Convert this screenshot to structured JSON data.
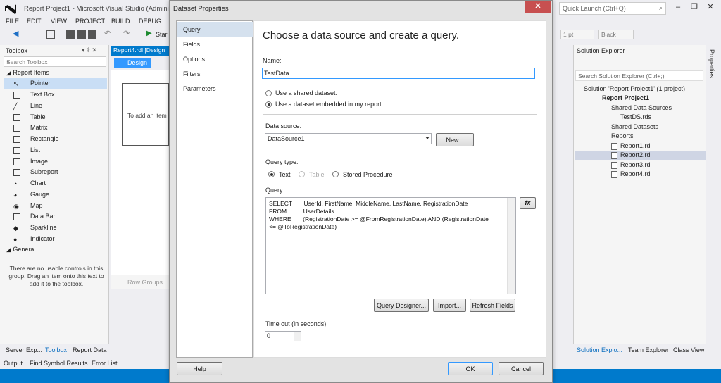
{
  "app": {
    "title": "Report Project1 - Microsoft Visual Studio (Administ",
    "quick_launch_placeholder": "Quick Launch (Ctrl+Q)"
  },
  "menu": [
    "FILE",
    "EDIT",
    "VIEW",
    "PROJECT",
    "BUILD",
    "DEBUG"
  ],
  "toolbar": {
    "start_label": "Star",
    "font_size": "1 pt",
    "color": "Black"
  },
  "toolbox": {
    "title": "Toolbox",
    "search_placeholder": "Search Toolbox",
    "group_report_items": "Report Items",
    "items": [
      "Pointer",
      "Text Box",
      "Line",
      "Table",
      "Matrix",
      "Rectangle",
      "List",
      "Image",
      "Subreport",
      "Chart",
      "Gauge",
      "Map",
      "Data Bar",
      "Sparkline",
      "Indicator"
    ],
    "group_general": "General",
    "empty_text": "There are no usable controls in this group. Drag an item onto this text to add it to the toolbox."
  },
  "document": {
    "tab": "Report4.rdl [Design",
    "design_button": "Design",
    "add_item_text": "To add an item",
    "row_groups": "Row Groups"
  },
  "bottom_tabs": {
    "left": [
      "Server Exp...",
      "Toolbox",
      "Report Data"
    ],
    "output": [
      "Output",
      "Find Symbol Results",
      "Error List"
    ],
    "right": [
      "Solution Explo...",
      "Team Explorer",
      "Class View"
    ]
  },
  "solution_explorer": {
    "title": "Solution Explorer",
    "search_placeholder": "Search Solution Explorer (Ctrl+;)",
    "solution": "Solution 'Report Project1' (1 project)",
    "project": "Report Project1",
    "shared_data_sources": "Shared Data Sources",
    "testds": "TestDS.rds",
    "shared_datasets": "Shared Datasets",
    "reports": "Reports",
    "report_files": [
      "Report1.rdl",
      "Report2.rdl",
      "Report3.rdl",
      "Report4.rdl"
    ]
  },
  "properties_strip": "Properties",
  "dialog": {
    "title": "Dataset Properties",
    "nav": [
      "Query",
      "Fields",
      "Options",
      "Filters",
      "Parameters"
    ],
    "heading": "Choose a data source and create a query.",
    "name_label": "Name:",
    "name_value": "TestData",
    "radio_shared": "Use a shared dataset.",
    "radio_embedded": "Use a dataset embedded in my report.",
    "datasource_label": "Data source:",
    "datasource_value": "DataSource1",
    "new_button": "New...",
    "querytype_label": "Query type:",
    "qt_text": "Text",
    "qt_table": "Table",
    "qt_sp": "Stored Procedure",
    "query_label": "Query:",
    "query_text": "SELECT       UserId, FirstName, MiddleName, LastName, RegistrationDate\nFROM          UserDetails\nWHERE       (RegistrationDate >= @FromRegistrationDate) AND (RegistrationDate\n<= @ToRegistrationDate)",
    "fx_button": "fx",
    "query_designer_button": "Query Designer...",
    "import_button": "Import...",
    "refresh_button": "Refresh Fields",
    "timeout_label": "Time out (in seconds):",
    "timeout_value": "0",
    "help_button": "Help",
    "ok_button": "OK",
    "cancel_button": "Cancel"
  }
}
